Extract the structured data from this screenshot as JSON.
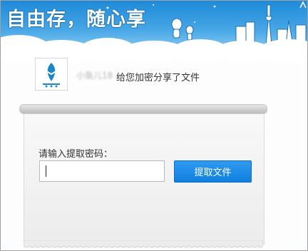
{
  "banner": {
    "slogan": "自由存，随心享"
  },
  "share": {
    "sender_name": "小鱼儿18",
    "message": "给您加密分享了文件"
  },
  "extract": {
    "prompt": "请输入提取密码：",
    "password_value": "",
    "button_label": "提取文件"
  },
  "colors": {
    "sky": "#1e8ad8",
    "button": "#1a88e8",
    "avatar_logo": "#1c86c8"
  },
  "icons": {
    "avatar": "logo-fish-icon",
    "banner": "cityscape-illustration"
  }
}
